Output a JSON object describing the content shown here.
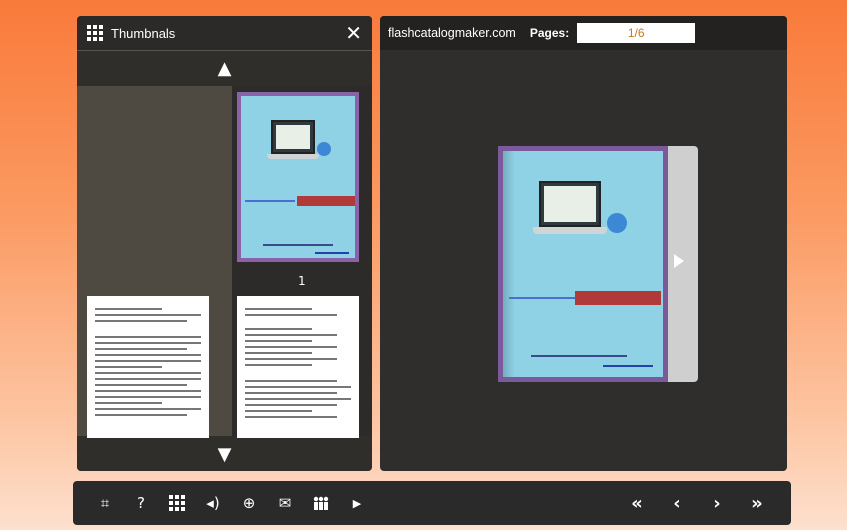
{
  "thumbnails_panel": {
    "title": "Thumbnals",
    "close_icon": "close-icon",
    "scroll_up_icon": "▲",
    "scroll_down_icon": "▼",
    "first_page_number": "1"
  },
  "viewer": {
    "site_name": "flashcatalogmaker.com",
    "pages_label": "Pages:",
    "pages_value": "1/6",
    "next_page_icon": "play-arrow-icon"
  },
  "toolbar": {
    "fullscreen_icon": "⌗",
    "help_icon": "?",
    "sound_icon": "◂)",
    "zoom_icon": "⊕",
    "email_icon": "✉",
    "play_icon": "▶",
    "first_icon": "«",
    "prev_icon": "‹",
    "next_icon": "›",
    "last_icon": "»"
  },
  "colors": {
    "background_top": "#f97a3a",
    "cover_border": "#7a5a9a",
    "cover_fill": "#8fd2e6",
    "pages_value_color": "#c07a1a"
  }
}
